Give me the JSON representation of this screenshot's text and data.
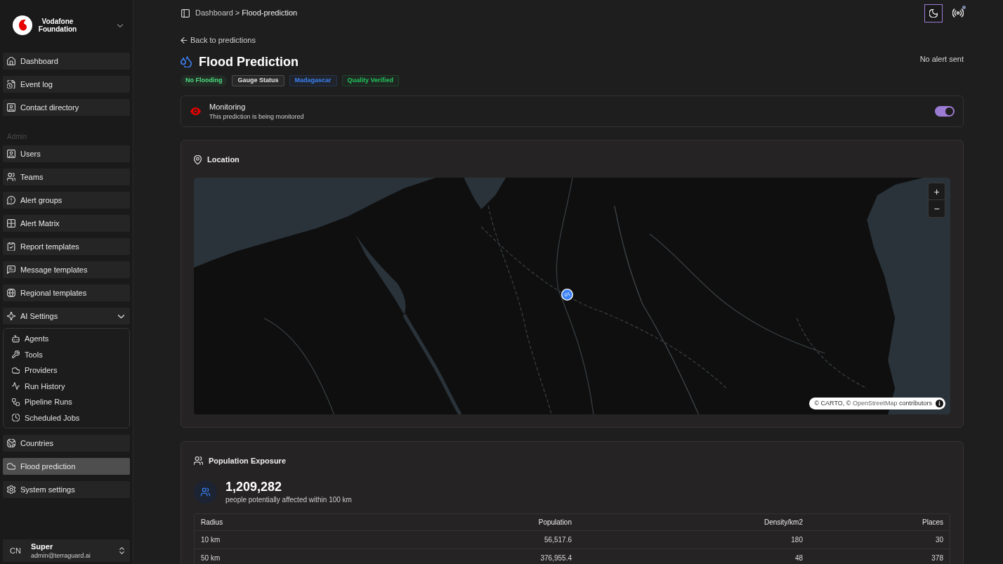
{
  "org": {
    "name": "Vodafone Foundation"
  },
  "sidebar": {
    "sections": [
      {
        "items": [
          {
            "label": "Dashboard",
            "selected": false
          },
          {
            "label": "Event log",
            "selected": false
          },
          {
            "label": "Contact directory",
            "selected": false
          }
        ]
      },
      {
        "heading": "Admin",
        "items": [
          {
            "label": "Users",
            "selected": false
          },
          {
            "label": "Teams",
            "selected": false
          },
          {
            "label": "Alert groups",
            "selected": false
          },
          {
            "label": "Alert Matrix",
            "selected": false
          },
          {
            "label": "Report templates",
            "selected": false
          },
          {
            "label": "Message templates",
            "selected": false
          },
          {
            "label": "Regional templates",
            "selected": false
          },
          {
            "label": "AI Settings",
            "selected": false,
            "expanded": true,
            "children": [
              {
                "label": "Agents",
                "selected": false
              },
              {
                "label": "Tools",
                "selected": false
              },
              {
                "label": "Providers",
                "selected": false
              },
              {
                "label": "Run History",
                "selected": false
              },
              {
                "label": "Pipeline Runs",
                "selected": false
              },
              {
                "label": "Scheduled Jobs",
                "selected": false
              }
            ]
          },
          {
            "label": "Countries",
            "selected": false
          },
          {
            "label": "Flood prediction",
            "selected": true
          },
          {
            "label": "System settings",
            "selected": false
          }
        ]
      }
    ]
  },
  "user": {
    "initials": "CN",
    "name": "Super",
    "email": "admin@terraguard.ai"
  },
  "breadcrumb": {
    "items": [
      "Dashboard",
      "Flood-prediction"
    ],
    "separator": ">"
  },
  "back_link": "Back to predictions",
  "title": "Flood Prediction",
  "alert_status": "No alert sent",
  "badges": [
    {
      "label": "No Flooding",
      "kind": "pill",
      "color": "#4ade80"
    },
    {
      "label": "Gauge Status",
      "kind": "outline",
      "color": "#e5e5e5"
    },
    {
      "label": "Madagascar",
      "kind": "outline",
      "color": "#3b82f6"
    },
    {
      "label": "Quality Verified",
      "kind": "outline",
      "color": "#22c55e"
    }
  ],
  "monitoring": {
    "title": "Monitoring",
    "description": "This prediction is being monitored",
    "on": true
  },
  "location": {
    "title": "Location",
    "map": {
      "zoom_in": "+",
      "zoom_out": "−",
      "attribution": {
        "text": "© CARTO, ©",
        "link": "OpenStreetMap",
        "suffix": "contributors"
      }
    }
  },
  "population": {
    "title": "Population Exposure",
    "total": "1,209,282",
    "caption": "people potentially affected within 100 km",
    "table": {
      "columns": [
        "Radius",
        "Population",
        "Density/km2",
        "Places"
      ],
      "rows": [
        [
          "10 km",
          "56,517.6",
          "180",
          "30"
        ],
        [
          "50 km",
          "376,955.4",
          "48",
          "378"
        ]
      ]
    }
  }
}
